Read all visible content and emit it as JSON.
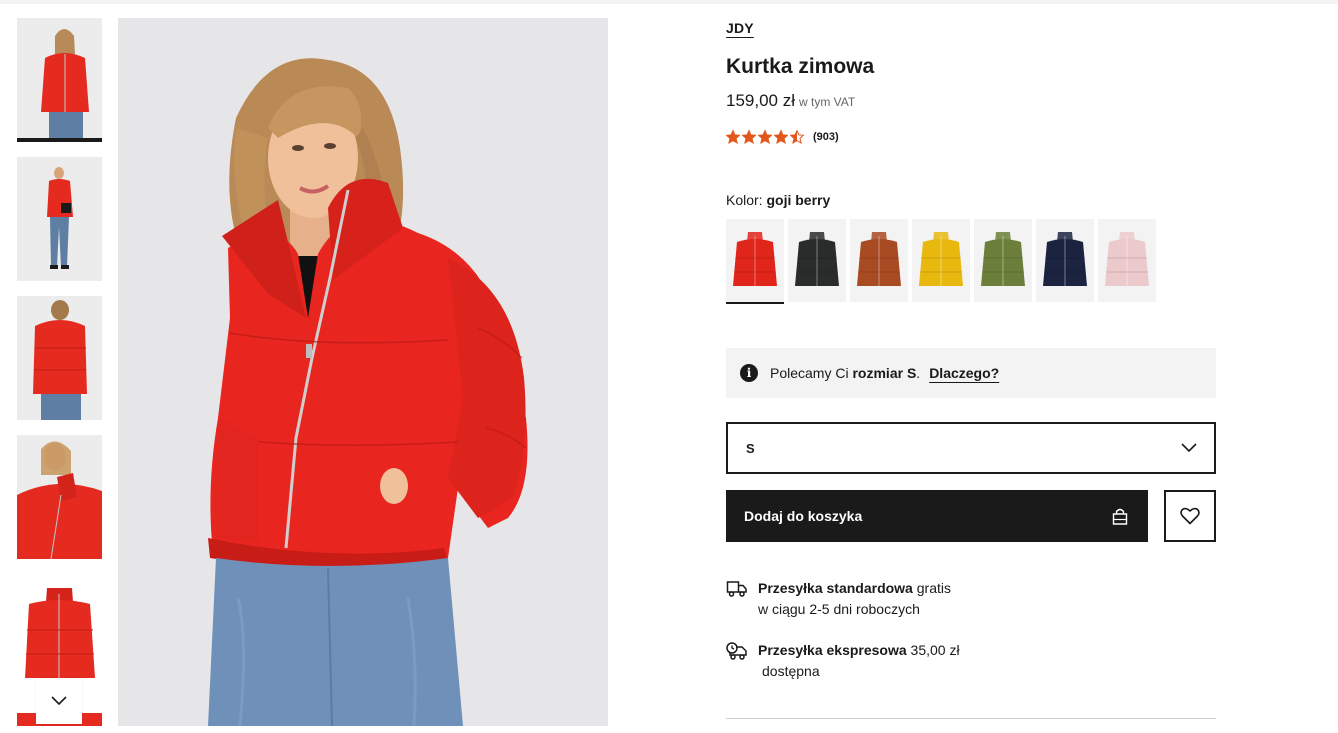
{
  "product": {
    "brand": "JDY",
    "title": "Kurtka zimowa",
    "price": "159,00 zł",
    "vat_note": "w tym VAT",
    "rating_value": 4.5,
    "review_count": "(903)"
  },
  "thumbnails": [
    {
      "label": "thumb-1",
      "active": true
    },
    {
      "label": "thumb-2",
      "active": false
    },
    {
      "label": "thumb-3",
      "active": false
    },
    {
      "label": "thumb-4",
      "active": false
    },
    {
      "label": "thumb-5",
      "active": false
    }
  ],
  "color": {
    "label": "Kolor:",
    "selected": "goji berry",
    "swatches": [
      {
        "name": "red",
        "hex": "#e0251b"
      },
      {
        "name": "black",
        "hex": "#2a2c2b"
      },
      {
        "name": "brown",
        "hex": "#a84a22"
      },
      {
        "name": "yellow",
        "hex": "#e8b80e"
      },
      {
        "name": "olive",
        "hex": "#6b7f3a"
      },
      {
        "name": "navy",
        "hex": "#1b2340"
      },
      {
        "name": "pink",
        "hex": "#ecc9cb"
      }
    ]
  },
  "recommendation": {
    "prefix": "Polecamy Ci",
    "size_text": "rozmiar S",
    "suffix": ".",
    "link": "Dlaczego?",
    "icon": "info-icon"
  },
  "size_select": {
    "value": "S",
    "icon": "chevron-down-icon"
  },
  "cart": {
    "add_label": "Dodaj do koszyka",
    "icon": "bag-icon",
    "wishlist_icon": "heart-icon"
  },
  "shipping": [
    {
      "title": "Przesyłka standardowa",
      "extra": "gratis",
      "sub": "w ciągu 2-5 dni roboczych",
      "icon": "truck-icon"
    },
    {
      "title": "Przesyłka ekspresowa",
      "extra": "35,00 zł",
      "sub": "dostępna",
      "icon": "express-truck-icon"
    }
  ],
  "colors": {
    "accent_star": "#e3571b",
    "primary": "#1a1a1a",
    "product_red": "#e8261f"
  }
}
